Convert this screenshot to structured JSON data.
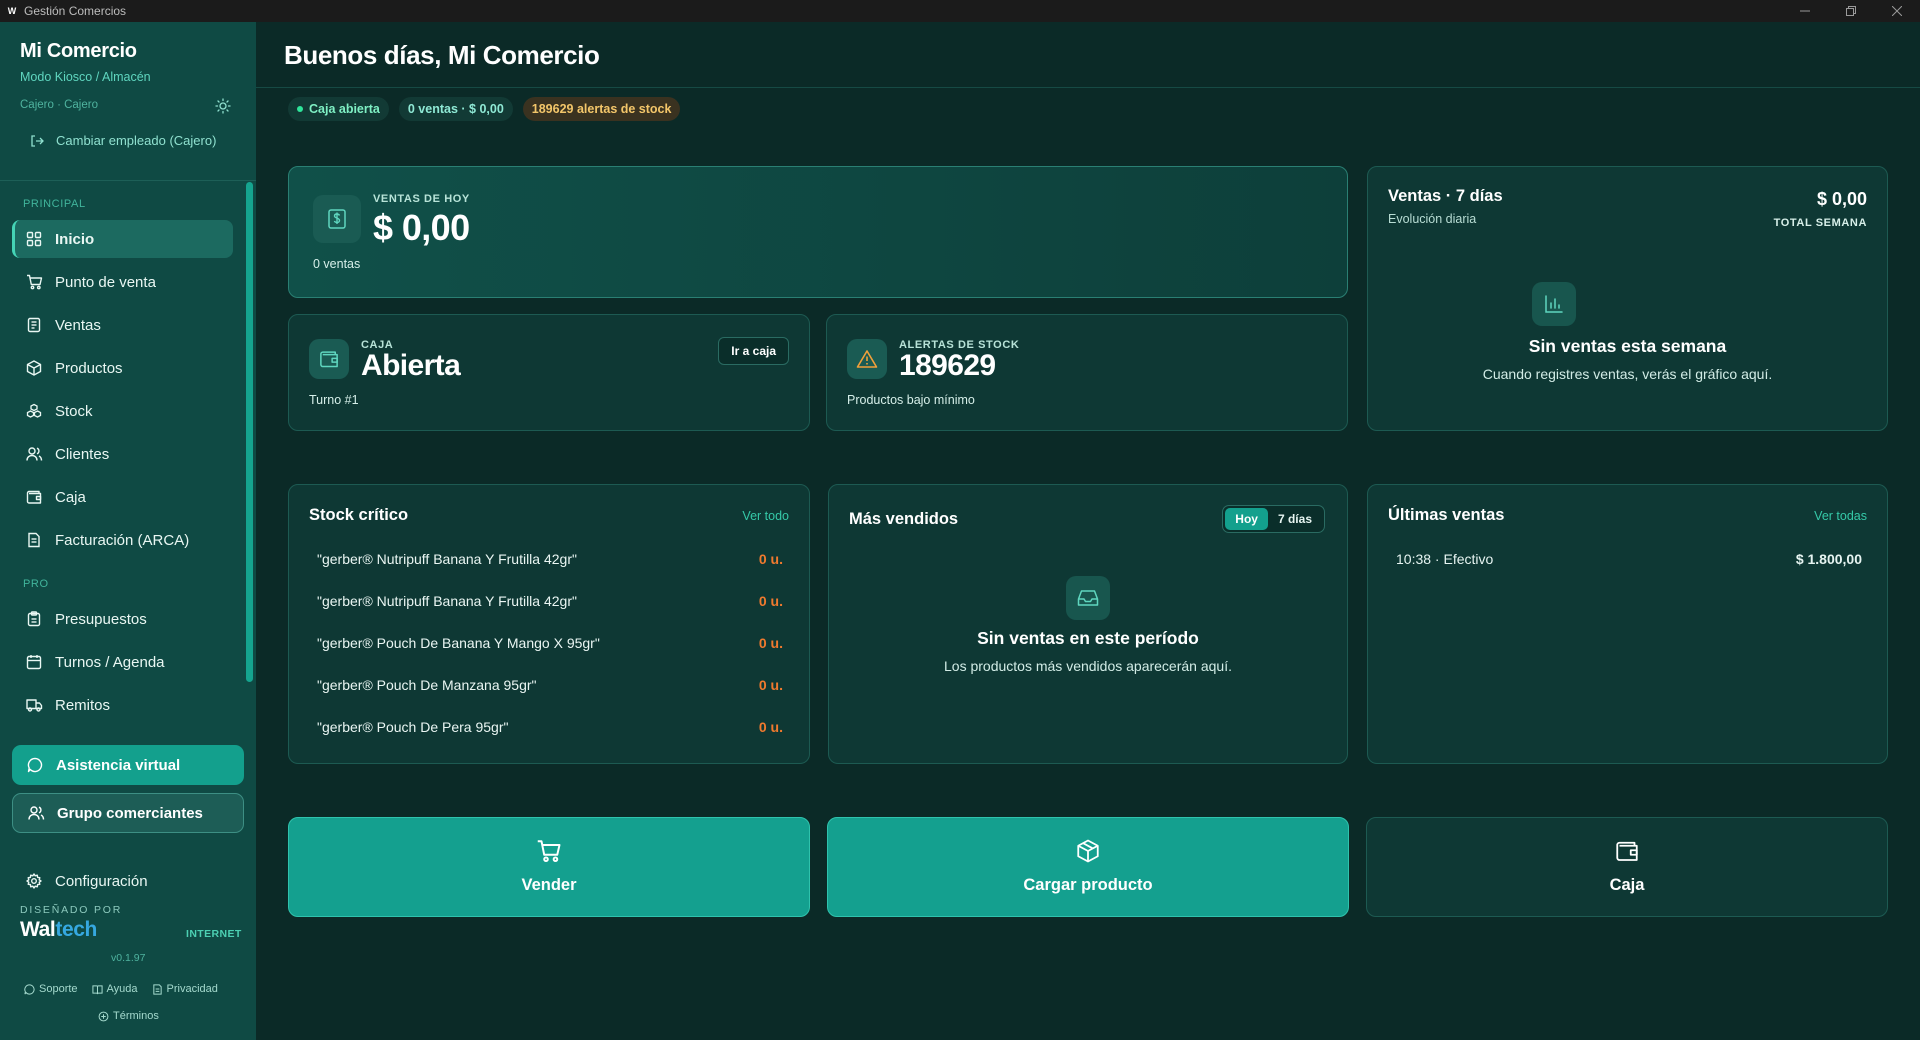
{
  "window": {
    "title": "Gestión Comercios",
    "app_icon": "W"
  },
  "sidebar": {
    "brand_name": "Mi Comercio",
    "mode": "Modo Kiosco / Almacén",
    "role": "Cajero · Cajero",
    "switch_employee": "Cambiar empleado (Cajero)",
    "sections": {
      "principal": "PRINCIPAL",
      "pro": "PRO"
    },
    "items": [
      {
        "label": "Inicio",
        "icon": "grid-icon",
        "active": true
      },
      {
        "label": "Punto de venta",
        "icon": "cart-icon"
      },
      {
        "label": "Ventas",
        "icon": "receipt-icon"
      },
      {
        "label": "Productos",
        "icon": "box-icon"
      },
      {
        "label": "Stock",
        "icon": "boxes-icon"
      },
      {
        "label": "Clientes",
        "icon": "users-icon"
      },
      {
        "label": "Caja",
        "icon": "wallet-icon"
      },
      {
        "label": "Facturación (ARCA)",
        "icon": "invoice-icon"
      }
    ],
    "pro_items": [
      {
        "label": "Presupuestos",
        "icon": "clipboard-icon"
      },
      {
        "label": "Turnos / Agenda",
        "icon": "calendar-icon"
      },
      {
        "label": "Remitos",
        "icon": "truck-icon"
      }
    ],
    "assist_button": "Asistencia virtual",
    "group_button": "Grupo comerciantes",
    "config": "Configuración",
    "designed_by": "DISEÑADO POR",
    "logo_wal": "Wal",
    "logo_tech": "tech",
    "connection": "INTERNET",
    "version": "v0.1.97",
    "footer": {
      "support": "Soporte",
      "help": "Ayuda",
      "privacy": "Privacidad",
      "terms": "Términos"
    }
  },
  "header": {
    "greeting": "Buenos días, Mi Comercio",
    "chips": {
      "cash_open": "Caja abierta",
      "sales": "0 ventas · $ 0,00",
      "alerts": "189629 alertas de stock"
    }
  },
  "kpis": {
    "today": {
      "label": "VENTAS DE HOY",
      "value": "$ 0,00",
      "sub": "0 ventas"
    },
    "cash": {
      "label": "CAJA",
      "value": "Abierta",
      "sub": "Turno #1",
      "button": "Ir a caja"
    },
    "alerts": {
      "label": "ALERTAS DE STOCK",
      "value": "189629",
      "sub": "Productos bajo mínimo"
    }
  },
  "weekly": {
    "title": "Ventas · 7 días",
    "subtitle": "Evolución diaria",
    "total": "$ 0,00",
    "total_label": "TOTAL SEMANA",
    "empty_title": "Sin ventas esta semana",
    "empty_sub": "Cuando registres ventas, verás el gráfico aquí."
  },
  "critical_stock": {
    "title": "Stock crítico",
    "link": "Ver todo",
    "rows": [
      {
        "name": "\"gerber® Nutripuff Banana Y Frutilla 42gr\"",
        "qty": "0 u."
      },
      {
        "name": "\"gerber® Nutripuff Banana Y Frutilla 42gr\"",
        "qty": "0 u."
      },
      {
        "name": "\"gerber® Pouch De Banana Y Mango X 95gr\"",
        "qty": "0 u."
      },
      {
        "name": "\"gerber® Pouch De Manzana 95gr\"",
        "qty": "0 u."
      },
      {
        "name": "\"gerber® Pouch De Pera 95gr\"",
        "qty": "0 u."
      }
    ]
  },
  "best_sellers": {
    "title": "Más vendidos",
    "toggle": [
      "Hoy",
      "7 días"
    ],
    "selected": "Hoy",
    "empty_title": "Sin ventas en este período",
    "empty_sub": "Los productos más vendidos aparecerán aquí."
  },
  "recent_sales": {
    "title": "Últimas ventas",
    "link": "Ver todas",
    "rows": [
      {
        "desc": "10:38 · Efectivo",
        "amount": "$ 1.800,00"
      }
    ]
  },
  "actions": {
    "sell": "Vender",
    "load_product": "Cargar producto",
    "cash": "Caja"
  },
  "colors": {
    "background": "#0b2a27",
    "sidebar": "#0f4a44",
    "accent": "#14a08f",
    "warning": "#f3c66a",
    "danger_qty": "#f07a2e"
  }
}
